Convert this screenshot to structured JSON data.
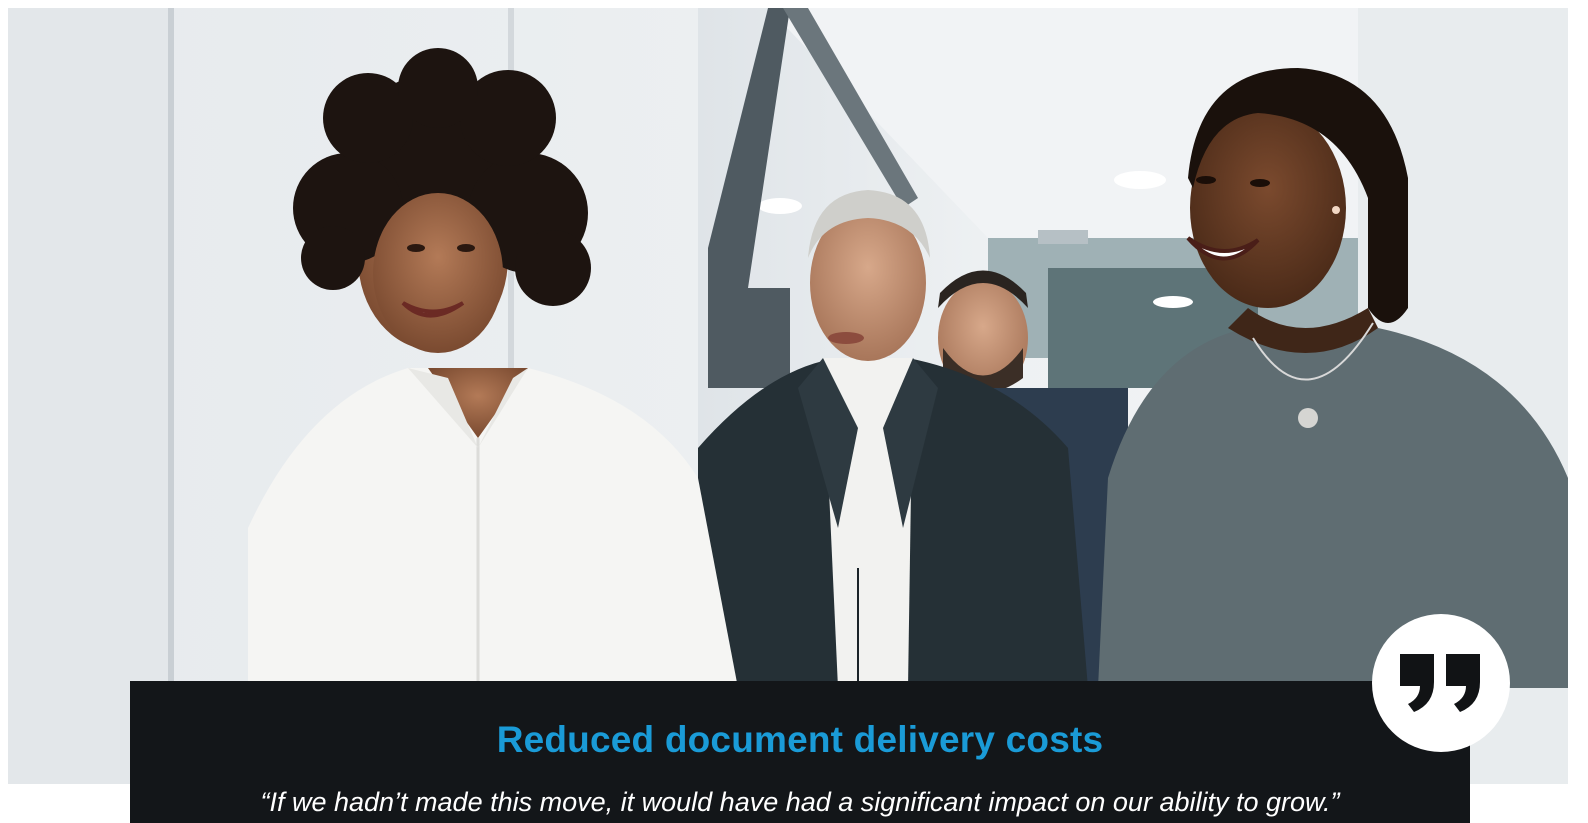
{
  "hero": {
    "image_icon": "office-team-photo"
  },
  "testimonial": {
    "title": "Reduced document delivery costs",
    "quote": "“If we hadn’t made this move, it would have had a significant impact on our ability to grow.”",
    "badge_icon": "quote-icon"
  },
  "colors": {
    "accent": "#1a9bd7",
    "panel": "#131619",
    "quote_text": "#ffffff"
  }
}
